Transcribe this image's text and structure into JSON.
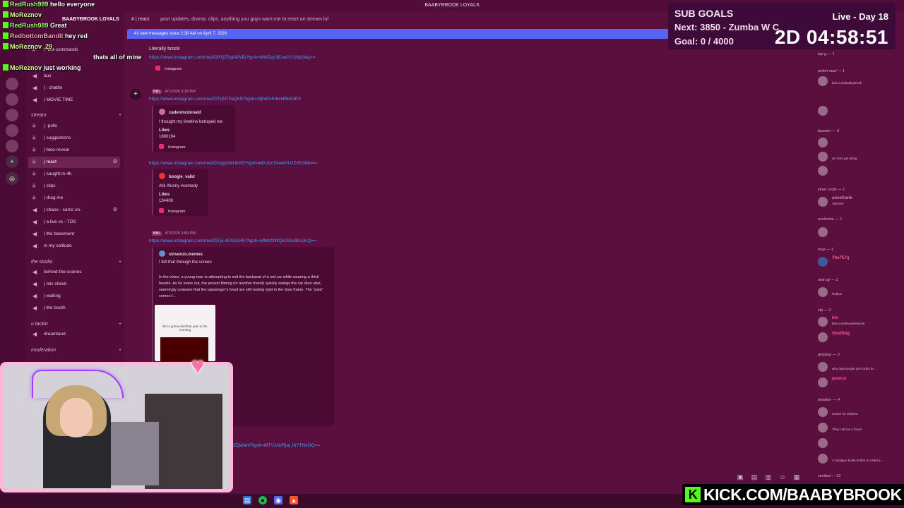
{
  "window_title": "BAABYBROOK LOYALS",
  "server": {
    "name": "BAABYBROOK LOYALS"
  },
  "overlay_chat": [
    {
      "user": "RedRush989",
      "text": "hello everyone"
    },
    {
      "user": "MoReznov",
      "text": ""
    },
    {
      "user": "RedRush989",
      "text": "Great"
    },
    {
      "user": "RedbottomBandit",
      "text": "hey red"
    },
    {
      "user": "",
      "text": "thats all of mine"
    },
    {
      "user": "MoReznov_29",
      "text": ""
    },
    {
      "user": "MoReznov",
      "text": "just working"
    }
  ],
  "channels": [
    {
      "name": "| -bot-commands",
      "type": "text"
    },
    {
      "name": "aux",
      "type": "voice"
    },
    {
      "name": "| : chattin",
      "type": "voice"
    },
    {
      "name": "| MOVIE TIME",
      "type": "voice"
    },
    {
      "category": "stream"
    },
    {
      "name": "| -polls",
      "type": "text"
    },
    {
      "name": "| suggestions",
      "type": "text"
    },
    {
      "name": "| face-reveal",
      "type": "text"
    },
    {
      "name": "| react",
      "type": "text",
      "active": true
    },
    {
      "name": "| caught-in-4k",
      "type": "text"
    },
    {
      "name": "| clips",
      "type": "text"
    },
    {
      "name": "| drag me",
      "type": "text"
    },
    {
      "name": "| chaos - cams on.",
      "type": "voice"
    },
    {
      "name": "| a live vc - TOS",
      "type": "voice"
    },
    {
      "name": "| the basement",
      "type": "voice"
    },
    {
      "name": "in my solitude",
      "type": "voice"
    },
    {
      "category": "the studio"
    },
    {
      "name": "behind-the-scenes",
      "type": "voice"
    },
    {
      "name": "| mic check",
      "type": "voice"
    },
    {
      "name": "| waiting",
      "type": "voice"
    },
    {
      "name": "| the booth",
      "type": "voice"
    },
    {
      "category": "u lackin"
    },
    {
      "name": "dreamland",
      "type": "voice"
    },
    {
      "category": "moderation"
    }
  ],
  "channel_header": {
    "name": "| react",
    "topic": "post updates, drama, clips, anything you guys want me to react on stream lol"
  },
  "new_messages_bar": "41 new messages since 2:38 AM on April 7, 2026",
  "messages": [
    {
      "text": "Literally brook",
      "link": "https://www.instagram.com/reel/DRQZ5qtAPvB/?igsh=MWZqc3ExeGY1Njd3eg==",
      "source": "Instagram"
    },
    {
      "author": "",
      "tag": "BBL",
      "time": "4/7/2026 3:38 PM",
      "link": "https://www.instagram.com/reel/DTqN70aQb9/?igsh=MjhtOHV6cHRkb3R3",
      "embed": {
        "author": "cadenmcdonald",
        "text": "I thought my timeline betrayed me",
        "likes_label": "Likes",
        "likes": "1880164",
        "source": "Instagram"
      }
    },
    {
      "link": "https://www.instagram.com/reel/DVgyGMUkfrE/?igsh=MXJocTAwdHUzZXE3Mw==",
      "embed": {
        "author": "boogie_valid",
        "text": "#lol #funny #comedy",
        "likes_label": "Likes",
        "likes": "134409",
        "source": "Instagram"
      }
    },
    {
      "author": "",
      "tag": "BBL",
      "time": "4/7/2026 3:59 PM",
      "link": "https://www.instagram.com/reel/DTyL4SSEoXK/?igsh=MWtlOWQ5OGo3b3JlcQ==",
      "embed": {
        "author": "sinsenzo.memes",
        "text": "I felt that through the screen",
        "description": "In the video, a young man is attempting to exit the backseat of a red car while wearing a thick hoodie. As he leans out, the person filming (or another friend) quickly swings the car door shut, seemingly unaware that the passenger's head are still resting right in the door frame. The \"pain\" comes f...",
        "thumb_caption": "Bro's gonna feel that pain in the morning"
      }
    },
    {
      "link": "...qa3ZjWaH/?igsh=MTV3NzRjaj J6YTNvOQ=="
    }
  ],
  "sub_goals": {
    "title": "SUB GOALS",
    "next": "Next: 3850 - Zumba W C",
    "goal": "Goal: 0 / 4000",
    "progress": 0,
    "live": "Live - Day 18",
    "timer": "2D 04:58:51"
  },
  "member_groups": [
    {
      "label": "top g — 1",
      "members": [
        {
          "name": "",
          "status": "kick.com/baabybrook"
        }
      ]
    },
    {
      "label": "twitch mod — 1",
      "members": [
        {
          "name": "",
          "status": ""
        }
      ]
    },
    {
      "label": "booster — 3",
      "members": [
        {
          "name": "",
          "status": ""
        },
        {
          "name": "",
          "status": "we dont get along"
        },
        {
          "name": "",
          "status": ""
        }
      ]
    },
    {
      "label": "inner circle — 1",
      "members": [
        {
          "name": "annefrank",
          "status": "Valorant"
        }
      ]
    },
    {
      "label": "exclusive — 1",
      "members": [
        {
          "name": "",
          "status": ""
        }
      ]
    },
    {
      "label": "mvp — 1",
      "members": [
        {
          "name": "The757q",
          "status": ""
        }
      ]
    },
    {
      "label": "real og — 1",
      "members": [
        {
          "name": "",
          "status": "Roblox"
        }
      ]
    },
    {
      "label": "vip — 2",
      "members": [
        {
          "name": "ktv",
          "status": "kick.com/ktvonlineturtle"
        },
        {
          "name": "ShotDog",
          "status": ""
        }
      ]
    },
    {
      "label": "girlypop — 2",
      "members": [
        {
          "name": "",
          "status": "why cant people just fuckin le..."
        },
        {
          "name": "jessica",
          "status": ""
        }
      ]
    },
    {
      "label": "tweaker — 4",
      "members": [
        {
          "name": "",
          "status": "Hunter for Dirttons"
        },
        {
          "name": "",
          "status": "They Left me 4 Dead"
        },
        {
          "name": "",
          "status": ""
        },
        {
          "name": "",
          "status": "A handgun bullet holder is called a..."
        }
      ]
    },
    {
      "label": "verified — 31",
      "members": []
    }
  ],
  "kick_banner": "KICK.COM/BAABYBROOK",
  "colors": {
    "bg": "#5a0f3f",
    "sidebar": "#520c3a",
    "link": "#38a6ff",
    "new_bar": "#5865f2",
    "kick_green": "#53fc18",
    "accent_pink": "#ff4f9e"
  }
}
